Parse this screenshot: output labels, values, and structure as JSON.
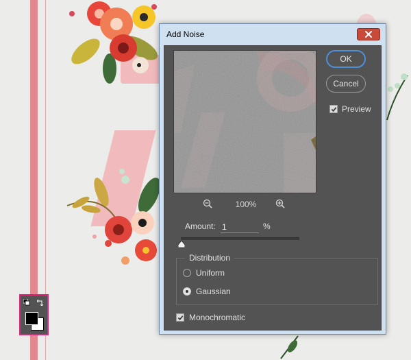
{
  "dialog": {
    "title": "Add Noise",
    "ok_label": "OK",
    "cancel_label": "Cancel",
    "preview_label": "Preview",
    "preview_checked": true,
    "zoom_level": "100%",
    "amount_label": "Amount:",
    "amount_value": "1",
    "amount_unit": "%",
    "amount_slider_fraction": 0.0,
    "distribution_label": "Distribution",
    "distribution_options": [
      "Uniform",
      "Gaussian"
    ],
    "distribution_selected": "Gaussian",
    "monochromatic_label": "Monochromatic",
    "monochromatic_checked": true
  },
  "tools": {
    "foreground_color": "#000000",
    "background_color": "#ffffff"
  },
  "colors": {
    "dialog_frame": "#cfe0f1",
    "panel_bg": "#535353",
    "ok_accent": "#4d8fd8",
    "close_button": "#c84a3b",
    "highlight_border": "#e2247a"
  }
}
